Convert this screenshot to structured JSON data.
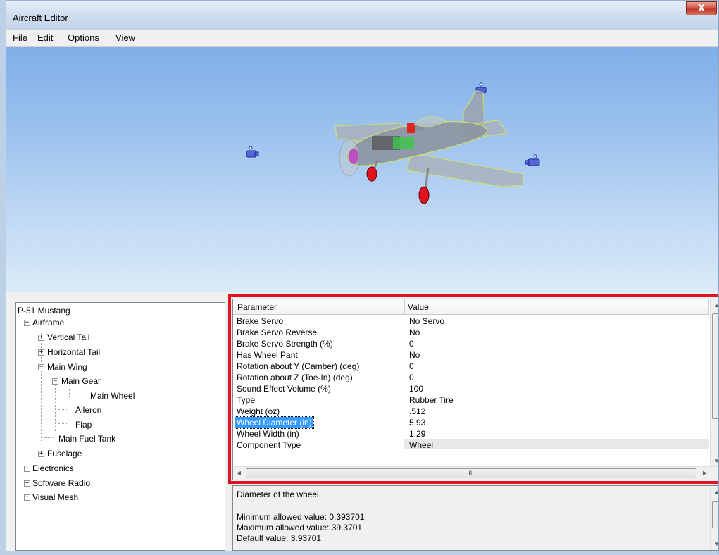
{
  "window": {
    "title": "Aircraft Editor",
    "close_glyph": "X"
  },
  "menu": [
    {
      "label": "File"
    },
    {
      "label": "Edit"
    },
    {
      "label": "Options"
    },
    {
      "label": "View"
    }
  ],
  "tree": {
    "root": "P-51 Mustang",
    "items": [
      {
        "label": "Airframe",
        "expander": "−"
      },
      {
        "label": "Vertical Tail",
        "expander": "+"
      },
      {
        "label": "Horizontal Tail",
        "expander": "+"
      },
      {
        "label": "Main Wing",
        "expander": "−"
      },
      {
        "label": "Main Gear",
        "expander": "−"
      },
      {
        "label": "Main Wheel",
        "expander": ""
      },
      {
        "label": "Aileron",
        "expander": ""
      },
      {
        "label": "Flap",
        "expander": ""
      },
      {
        "label": "Main Fuel Tank",
        "expander": ""
      },
      {
        "label": "Fuselage",
        "expander": "+"
      },
      {
        "label": "Electronics",
        "expander": "+"
      },
      {
        "label": "Software Radio",
        "expander": "+"
      },
      {
        "label": "Visual Mesh",
        "expander": "+"
      }
    ]
  },
  "grid": {
    "headers": {
      "parameter": "Parameter",
      "value": "Value"
    },
    "rows": [
      {
        "name": "Brake Servo",
        "value": "No Servo"
      },
      {
        "name": "Brake Servo Reverse",
        "value": "No"
      },
      {
        "name": "Brake Servo Strength (%)",
        "value": "0"
      },
      {
        "name": "Has Wheel Pant",
        "value": "No"
      },
      {
        "name": "Rotation about Y (Camber) (deg)",
        "value": "0"
      },
      {
        "name": "Rotation about Z (Toe-In) (deg)",
        "value": "0"
      },
      {
        "name": "Sound Effect Volume (%)",
        "value": "100"
      },
      {
        "name": "Type",
        "value": "Rubber Tire"
      },
      {
        "name": "Weight (oz)",
        "value": ".512"
      },
      {
        "name": "Wheel Diameter (in)",
        "value": "5.93"
      },
      {
        "name": "Wheel Width (in)",
        "value": "1.29"
      },
      {
        "name": "Component Type",
        "value": "Wheel"
      }
    ],
    "hscroll_grip": "III"
  },
  "description": {
    "text": "Diameter of the wheel.",
    "min": "Minimum allowed value: 0.393701",
    "max": "Maximum allowed value: 39.3701",
    "default": "Default value: 3.93701"
  },
  "colors": {
    "highlight_border": "#e0141e",
    "selection": "#3399ff",
    "sky_top": "#7faee8"
  }
}
